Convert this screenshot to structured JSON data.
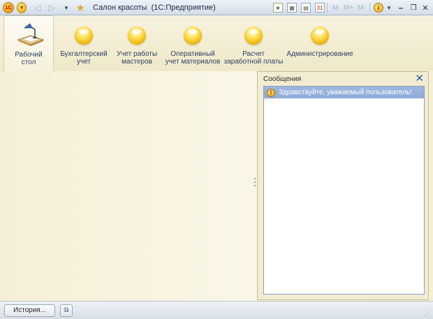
{
  "window": {
    "logo_text": "1С",
    "title": "Салон красоты  (1С:Предприятие)",
    "mem_buttons": [
      "M",
      "M+",
      "M-"
    ],
    "controls": {
      "info": "i",
      "minimize": "–",
      "restore": "❐",
      "close": "✕"
    }
  },
  "sections": [
    {
      "label": "Рабочий\nстол",
      "icon": "desktop-icon",
      "active": true
    },
    {
      "label": "Бухгалтерский\nучет",
      "icon": "section-ball-icon"
    },
    {
      "label": "Учет работы\nмастеров",
      "icon": "section-ball-icon"
    },
    {
      "label": "Оперативный\nучет материалов",
      "icon": "section-ball-icon"
    },
    {
      "label": "Расчет\nзаработной платы",
      "icon": "section-ball-icon"
    },
    {
      "label": "Администрирование",
      "icon": "section-ball-icon"
    }
  ],
  "messages": {
    "title": "Сообщения",
    "close_glyph": "✕",
    "items": [
      {
        "text": "Здравствуйте, уважаемый пользователь!",
        "icon": "warning-icon"
      }
    ]
  },
  "statusbar": {
    "history_label": "История...",
    "icon": "windows-list-icon"
  }
}
